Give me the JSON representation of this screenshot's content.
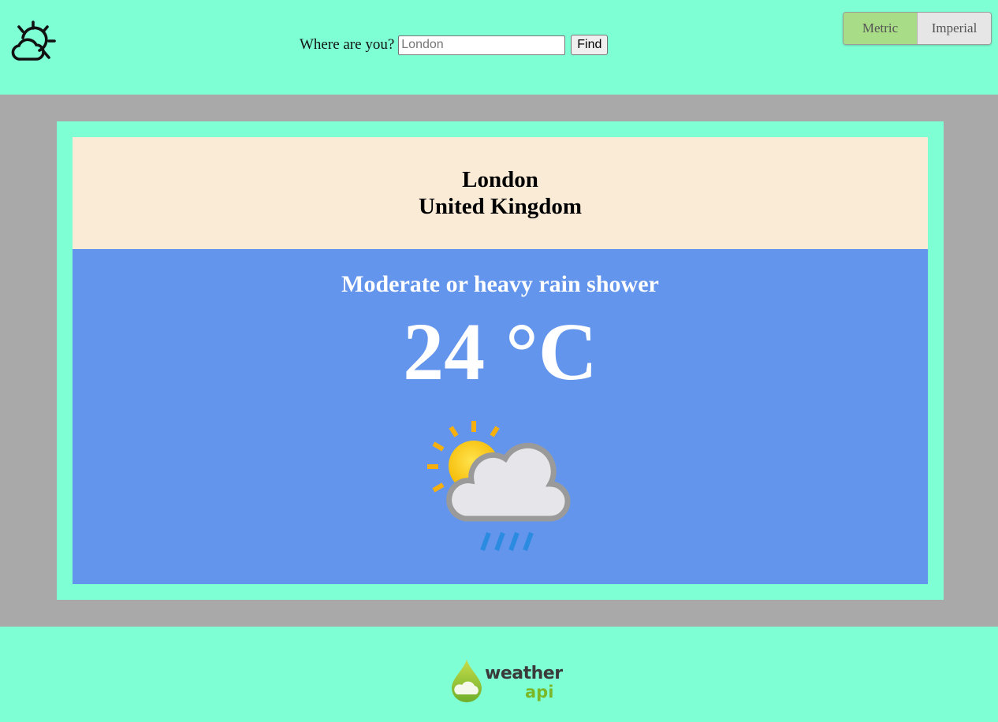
{
  "header": {
    "search_label": "Where are you?",
    "search_placeholder": "London",
    "find_label": "Find",
    "units": {
      "metric": "Metric",
      "imperial": "Imperial",
      "selected": "metric"
    }
  },
  "location": {
    "city": "London",
    "country": "United Kingdom"
  },
  "weather": {
    "condition": "Moderate or heavy rain shower",
    "temperature": "24 °C",
    "icon": "sun-cloud-rain-icon"
  },
  "footer": {
    "logo_word": "weather",
    "logo_sub": "api"
  },
  "colors": {
    "page": "#7fffd4",
    "main_bg": "#a9a9a9",
    "location_bg": "#faebd7",
    "weather_bg": "#6495ed",
    "metric_active": "#a8dc86"
  }
}
